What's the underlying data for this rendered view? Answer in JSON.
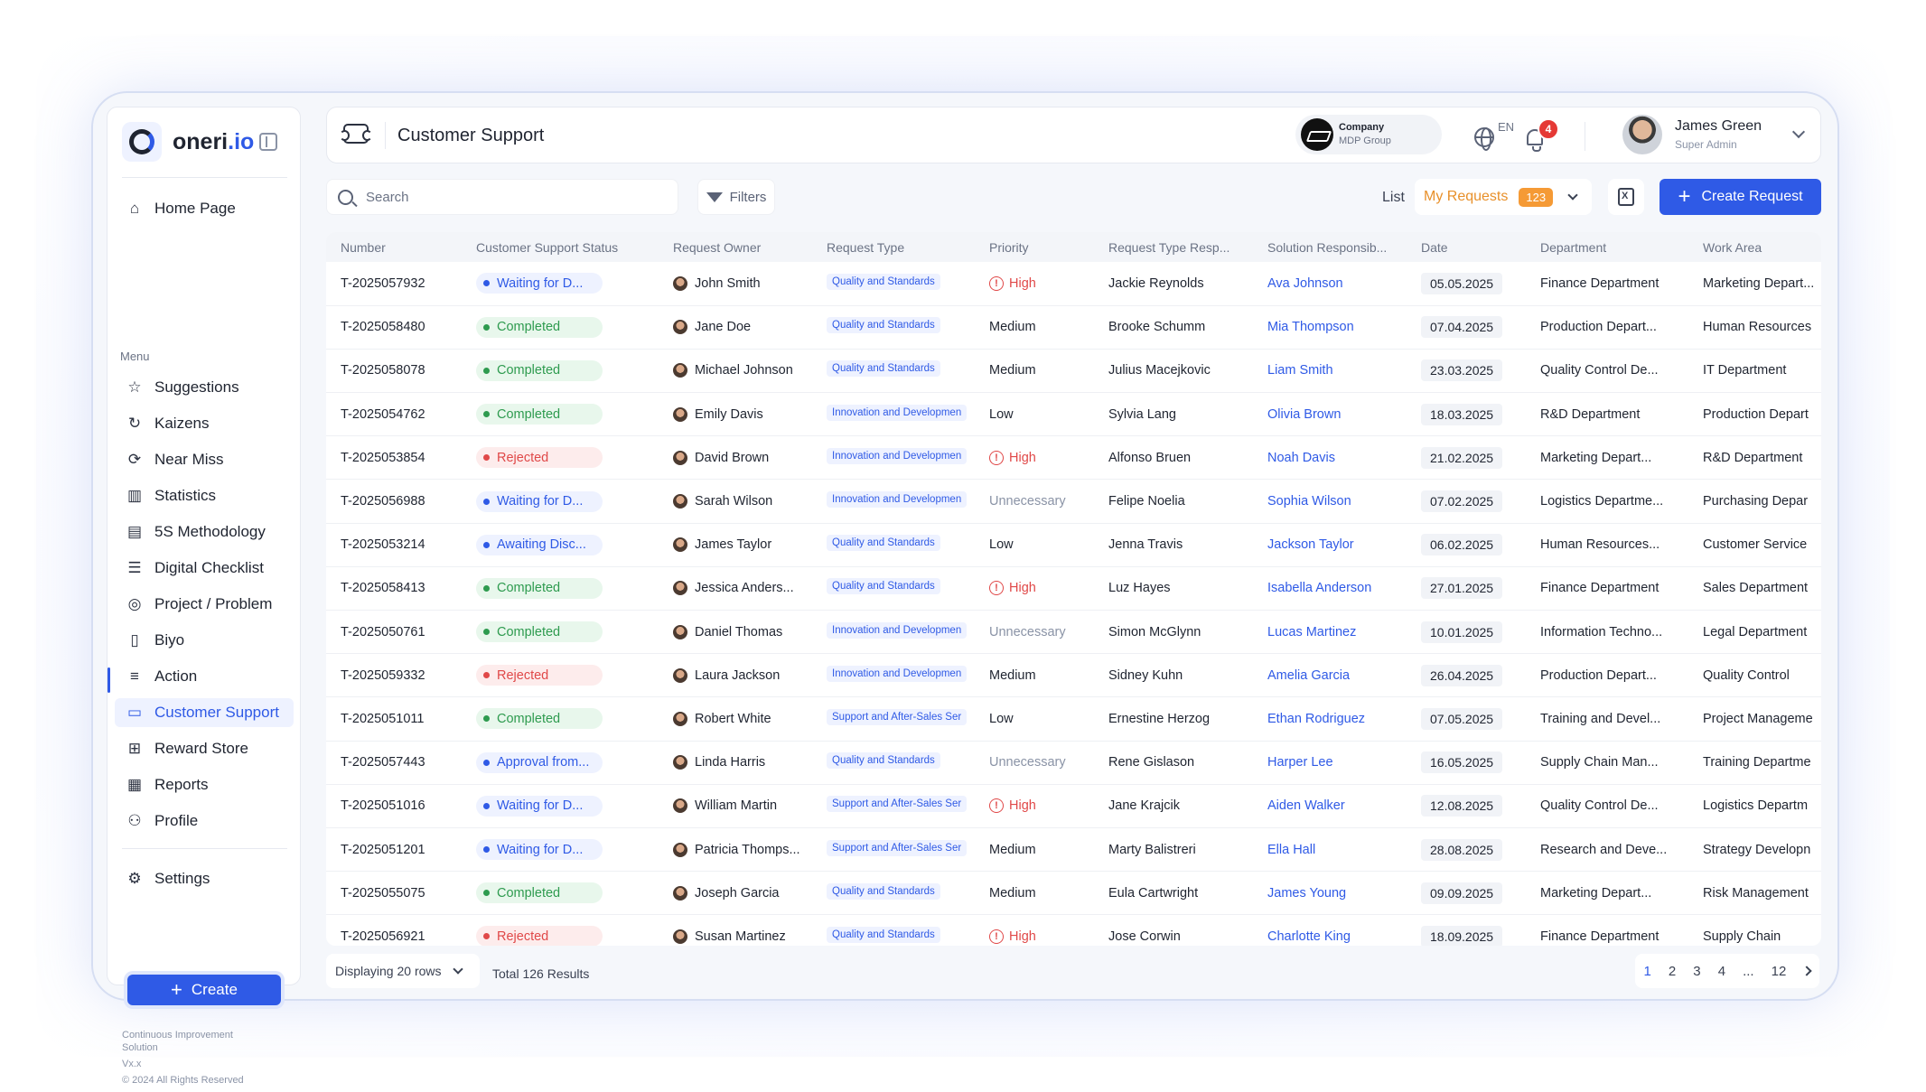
{
  "brand": {
    "name": "oneri",
    "suffix": ".io"
  },
  "sidebar": {
    "home": "Home Page",
    "menu_label": "Menu",
    "items": [
      {
        "label": "Suggestions",
        "icon": "star-icon"
      },
      {
        "label": "Kaizens",
        "icon": "refresh-icon"
      },
      {
        "label": "Near Miss",
        "icon": "near-miss-icon"
      },
      {
        "label": "Statistics",
        "icon": "bar-chart-icon"
      },
      {
        "label": "5S Methodology",
        "icon": "clipboard-icon"
      },
      {
        "label": "Digital Checklist",
        "icon": "checklist-icon"
      },
      {
        "label": "Project / Problem",
        "icon": "target-icon"
      },
      {
        "label": "Biyo",
        "icon": "book-icon"
      },
      {
        "label": "Action",
        "icon": "list-icon"
      },
      {
        "label": "Customer Support",
        "icon": "ticket-icon"
      },
      {
        "label": "Reward Store",
        "icon": "gift-icon"
      },
      {
        "label": "Reports",
        "icon": "report-icon"
      },
      {
        "label": "Profile",
        "icon": "user-icon"
      }
    ],
    "settings": "Settings",
    "create": "Create",
    "footer": {
      "line1": "Continuous Improvement",
      "line2": "Solution",
      "version": "Vx.x",
      "copyright": "© 2024 All Rights Reserved"
    }
  },
  "header": {
    "title": "Customer Support",
    "company_label": "Company",
    "company_name": "MDP Group",
    "language": "EN",
    "notifications": "4",
    "user_name": "James Green",
    "user_role": "Super Admin"
  },
  "toolbar": {
    "search_placeholder": "Search",
    "filters": "Filters",
    "list_label": "List",
    "my_requests": "My Requests",
    "my_requests_count": "123",
    "create_request": "Create Request"
  },
  "table": {
    "columns": [
      "Number",
      "Customer Support Status",
      "Request Owner",
      "Request Type",
      "Priority",
      "Request Type Resp...",
      "Solution Responsib...",
      "Date",
      "Department",
      "Work Area"
    ],
    "rows": [
      {
        "number": "T-2025057932",
        "status": "Waiting for D...",
        "status_kind": "waiting",
        "owner": "John Smith",
        "type": "Quality and Standards",
        "priority": "High",
        "priority_kind": "high",
        "type_resp": "Jackie Reynolds",
        "solution": "Ava Johnson",
        "date": "05.05.2025",
        "dept": "Finance Department",
        "area": "Marketing Depart..."
      },
      {
        "number": "T-2025058480",
        "status": "Completed",
        "status_kind": "completed",
        "owner": "Jane Doe",
        "type": "Quality and Standards",
        "priority": "Medium",
        "priority_kind": "normal",
        "type_resp": "Brooke Schumm",
        "solution": "Mia Thompson",
        "date": "07.04.2025",
        "dept": "Production Depart...",
        "area": "Human Resources"
      },
      {
        "number": "T-2025058078",
        "status": "Completed",
        "status_kind": "completed",
        "owner": "Michael Johnson",
        "type": "Quality and Standards",
        "priority": "Medium",
        "priority_kind": "normal",
        "type_resp": "Julius Macejkovic",
        "solution": "Liam Smith",
        "date": "23.03.2025",
        "dept": "Quality Control De...",
        "area": "IT Department"
      },
      {
        "number": "T-2025054762",
        "status": "Completed",
        "status_kind": "completed",
        "owner": "Emily Davis",
        "type": "Innovation and Developmen",
        "priority": "Low",
        "priority_kind": "normal",
        "type_resp": "Sylvia Lang",
        "solution": "Olivia Brown",
        "date": "18.03.2025",
        "dept": "R&D Department",
        "area": "Production Depart"
      },
      {
        "number": "T-2025053854",
        "status": "Rejected",
        "status_kind": "rejected",
        "owner": "David Brown",
        "type": "Innovation and Developmen",
        "priority": "High",
        "priority_kind": "high",
        "type_resp": "Alfonso Bruen",
        "solution": "Noah Davis",
        "date": "21.02.2025",
        "dept": "Marketing Depart...",
        "area": "R&D Department"
      },
      {
        "number": "T-2025056988",
        "status": "Waiting for D...",
        "status_kind": "waiting",
        "owner": "Sarah Wilson",
        "type": "Innovation and Developmen",
        "priority": "Unnecessary",
        "priority_kind": "unnecessary",
        "type_resp": "Felipe Noelia",
        "solution": "Sophia Wilson",
        "date": "07.02.2025",
        "dept": "Logistics Departme...",
        "area": "Purchasing Depar"
      },
      {
        "number": "T-2025053214",
        "status": "Awaiting Disc...",
        "status_kind": "waiting",
        "owner": "James Taylor",
        "type": "Quality and Standards",
        "priority": "Low",
        "priority_kind": "normal",
        "type_resp": "Jenna Travis",
        "solution": "Jackson Taylor",
        "date": "06.02.2025",
        "dept": "Human Resources...",
        "area": "Customer Service"
      },
      {
        "number": "T-2025058413",
        "status": "Completed",
        "status_kind": "completed",
        "owner": "Jessica Anders...",
        "type": "Quality and Standards",
        "priority": "High",
        "priority_kind": "high",
        "type_resp": "Luz Hayes",
        "solution": "Isabella Anderson",
        "date": "27.01.2025",
        "dept": "Finance Department",
        "area": "Sales Department"
      },
      {
        "number": "T-2025050761",
        "status": "Completed",
        "status_kind": "completed",
        "owner": "Daniel Thomas",
        "type": "Innovation and Developmen",
        "priority": "Unnecessary",
        "priority_kind": "unnecessary",
        "type_resp": "Simon McGlynn",
        "solution": "Lucas Martinez",
        "date": "10.01.2025",
        "dept": "Information Techno...",
        "area": "Legal Department"
      },
      {
        "number": "T-2025059332",
        "status": "Rejected",
        "status_kind": "rejected",
        "owner": "Laura Jackson",
        "type": "Innovation and Developmen",
        "priority": "Medium",
        "priority_kind": "normal",
        "type_resp": "Sidney Kuhn",
        "solution": "Amelia Garcia",
        "date": "26.04.2025",
        "dept": "Production Depart...",
        "area": "Quality Control"
      },
      {
        "number": "T-2025051011",
        "status": "Completed",
        "status_kind": "completed",
        "owner": "Robert White",
        "type": "Support and After-Sales Ser",
        "priority": "Low",
        "priority_kind": "normal",
        "type_resp": "Ernestine Herzog",
        "solution": "Ethan Rodriguez",
        "date": "07.05.2025",
        "dept": "Training and Devel...",
        "area": "Project Manageme"
      },
      {
        "number": "T-2025057443",
        "status": "Approval from...",
        "status_kind": "waiting",
        "owner": "Linda Harris",
        "type": "Quality and Standards",
        "priority": "Unnecessary",
        "priority_kind": "unnecessary",
        "type_resp": "Rene Gislason",
        "solution": "Harper Lee",
        "date": "16.05.2025",
        "dept": "Supply Chain Man...",
        "area": "Training Departme"
      },
      {
        "number": "T-2025051016",
        "status": "Waiting for D...",
        "status_kind": "waiting",
        "owner": "William Martin",
        "type": "Support and After-Sales Ser",
        "priority": "High",
        "priority_kind": "high",
        "type_resp": "Jane Krajcik",
        "solution": "Aiden Walker",
        "date": "12.08.2025",
        "dept": "Quality Control De...",
        "area": "Logistics Departm"
      },
      {
        "number": "T-2025051201",
        "status": "Waiting for D...",
        "status_kind": "waiting",
        "owner": "Patricia Thomps...",
        "type": "Support and After-Sales Ser",
        "priority": "Medium",
        "priority_kind": "normal",
        "type_resp": "Marty Balistreri",
        "solution": "Ella Hall",
        "date": "28.08.2025",
        "dept": "Research and Deve...",
        "area": "Strategy Developn"
      },
      {
        "number": "T-2025055075",
        "status": "Completed",
        "status_kind": "completed",
        "owner": "Joseph Garcia",
        "type": "Quality and Standards",
        "priority": "Medium",
        "priority_kind": "normal",
        "type_resp": "Eula Cartwright",
        "solution": "James Young",
        "date": "09.09.2025",
        "dept": "Marketing Depart...",
        "area": "Risk Management"
      },
      {
        "number": "T-2025056921",
        "status": "Rejected",
        "status_kind": "rejected",
        "owner": "Susan Martinez",
        "type": "Quality and Standards",
        "priority": "High",
        "priority_kind": "high",
        "type_resp": "Jose Corwin",
        "solution": "Charlotte King",
        "date": "18.09.2025",
        "dept": "Finance Department",
        "area": "Supply Chain"
      }
    ]
  },
  "footer": {
    "rows_label": "Displaying 20 rows",
    "total": "Total 126 Results",
    "pages": [
      "1",
      "2",
      "3",
      "4",
      "...",
      "12"
    ],
    "active_page": "1"
  },
  "colors": {
    "accent": "#2f5ae6",
    "orange": "#f59a35",
    "success": "#2e9b4f",
    "danger": "#e04848"
  }
}
